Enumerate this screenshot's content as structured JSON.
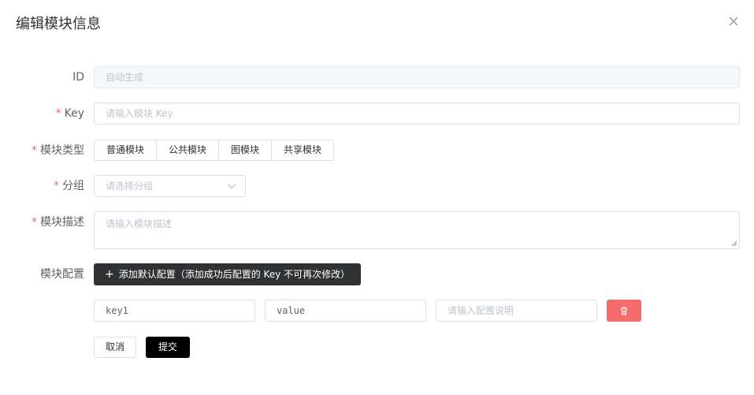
{
  "dialog": {
    "title": "编辑模块信息"
  },
  "form": {
    "id": {
      "label": "ID",
      "placeholder": "自动生成",
      "required": false
    },
    "key": {
      "label": "Key",
      "placeholder": "请输入模块 Key",
      "required": true
    },
    "type": {
      "label": "模块类型",
      "required": true,
      "options": [
        "普通模块",
        "公共模块",
        "图模块",
        "共享模块"
      ]
    },
    "group": {
      "label": "分组",
      "placeholder": "请选择分组",
      "required": true
    },
    "description": {
      "label": "模块描述",
      "placeholder": "请输入模块描述",
      "required": true
    },
    "config": {
      "label": "模块配置",
      "add_button": "添加默认配置（添加成功后配置的 Key 不可再次修改）",
      "rows": [
        {
          "key": "key1",
          "value": "value",
          "desc_placeholder": "请输入配置说明"
        }
      ]
    }
  },
  "footer": {
    "cancel_label": "取消",
    "submit_label": "提交"
  },
  "icons": {
    "close": "close-icon",
    "dropdown": "chevron-down-icon",
    "add": "plus-icon",
    "delete": "trash-icon"
  },
  "colors": {
    "required": "#f56c6c",
    "primary_dark": "#303133",
    "submit": "#000000",
    "danger": "#f56c6c"
  }
}
